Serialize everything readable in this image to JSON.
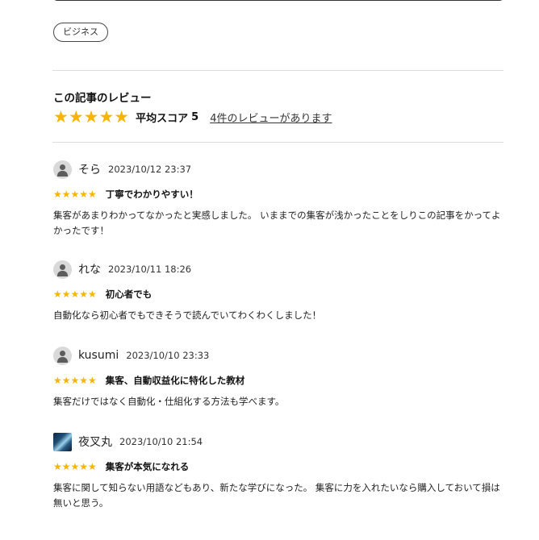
{
  "tag": {
    "label": "ビジネス"
  },
  "reviews_section": {
    "title": "この記事のレビュー",
    "rating_stars": "★★★★★",
    "avg_label": "平均スコア",
    "avg_score": "5",
    "count_link": "4件のレビューがあります"
  },
  "reviews": [
    {
      "avatar": "person-icon",
      "username": "そら",
      "datetime": "2023/10/12 23:37",
      "stars": "★★★★★",
      "rating": 5,
      "title": "丁寧でわかりやすい！",
      "body": "集客があまりわかってなかったと実感しました。 いままでの集客が浅かったことをしりこの記事をかってよかったです！"
    },
    {
      "avatar": "person-icon",
      "username": "れな",
      "datetime": "2023/10/11 18:26",
      "stars": "★★★★★",
      "rating": 5,
      "title": "初心者でも",
      "body": "自動化なら初心者でもできそうで読んでいてわくわくしました！"
    },
    {
      "avatar": "person-icon",
      "username": "kusumi",
      "datetime": "2023/10/10 23:33",
      "stars": "★★★★★",
      "rating": 5,
      "title": "集客、自動収益化に特化した教材",
      "body": "集客だけではなく自動化・仕組化する方法も学べます。"
    },
    {
      "avatar": "user-photo",
      "username": "夜叉丸",
      "datetime": "2023/10/10 21:54",
      "stars": "★★★★★",
      "rating": 5,
      "title": "集客が本気になれる",
      "body": "集客に関して知らない用語などもあり、新たな学びになった。 集客に力を入れたいなら購入しておいて損は無いと思う。"
    }
  ],
  "colors": {
    "star": "#f6b500",
    "divider": "#dddddd",
    "text": "#222222"
  }
}
